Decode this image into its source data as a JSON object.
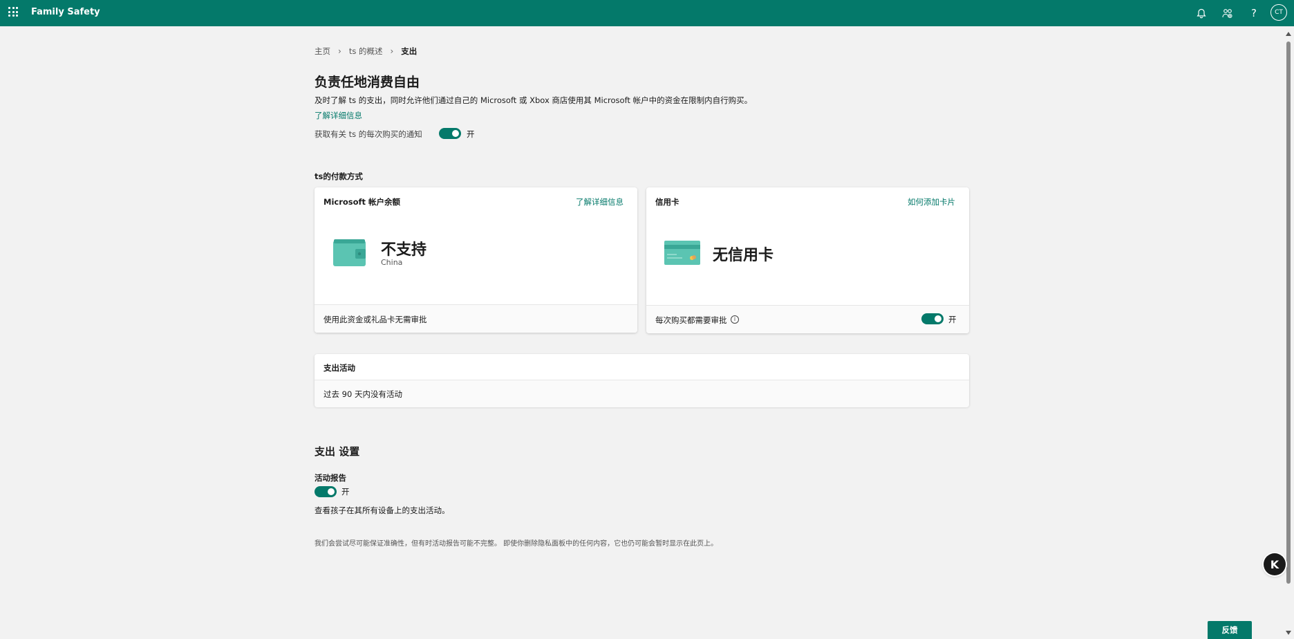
{
  "topbar": {
    "app_title": "Family Safety",
    "avatar_initials": "CT",
    "icons": [
      "waffle-icon",
      "bell-icon",
      "family-icon",
      "help-icon"
    ]
  },
  "breadcrumb": {
    "home": "主页",
    "overview": "ts 的概述",
    "current": "支出"
  },
  "header": {
    "title": "负责任地消费自由",
    "description": "及时了解 ts 的支出，同时允许他们通过自己的 Microsoft 或 Xbox 商店使用其 Microsoft 帐户中的资金在限制内自行购买。",
    "learn_more": "了解详细信息",
    "notify_label": "获取有关 ts 的每次购买的通知",
    "notify_state": "开"
  },
  "payment": {
    "section_title": "ts的付款方式",
    "balance_card": {
      "title": "Microsoft 帐户余额",
      "link": "了解详细信息",
      "status": "不支持",
      "region": "China",
      "footer": "使用此资金或礼品卡无需审批"
    },
    "credit_card": {
      "title": "信用卡",
      "link": "如何添加卡片",
      "status": "无信用卡",
      "footer": "每次购买都需要审批",
      "toggle_state": "开"
    }
  },
  "activity": {
    "title": "支出活动",
    "empty": "过去 90 天内没有活动"
  },
  "settings": {
    "title": "支出 设置",
    "report_title": "活动报告",
    "report_state": "开",
    "report_desc": "查看孩子在其所有设备上的支出活动。",
    "disclaimer": "我们会尝试尽可能保证准确性，但有时活动报告可能不完整。 即使你删除隐私面板中的任何内容，它也仍可能会暂时显示在此页上。"
  },
  "feedback_label": "反馈",
  "colors": {
    "brand": "#04796a",
    "card_teal": "#5bc4b2"
  }
}
